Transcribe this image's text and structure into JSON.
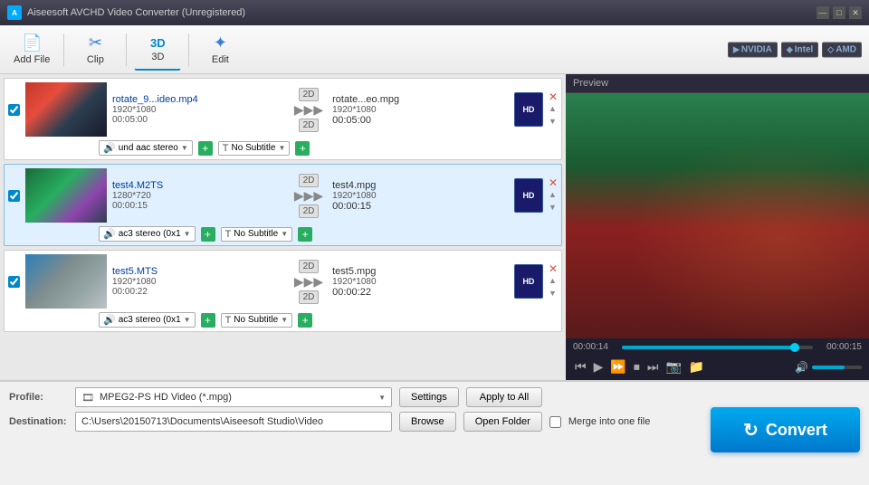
{
  "window": {
    "title": "Aiseesoft AVCHD Video Converter (Unregistered)"
  },
  "toolbar": {
    "add_file_label": "Add File",
    "clip_label": "Clip",
    "label_3d": "3D",
    "edit_label": "Edit",
    "hw_badges": [
      "NVIDIA",
      "Intel",
      "AMD"
    ]
  },
  "filelist": {
    "files": [
      {
        "id": "file1",
        "checked": true,
        "input_name": "rotate_9...ideo.mp4",
        "input_dim": "1920*1080",
        "input_dur": "00:05:00",
        "output_name": "rotate...eo.mpg",
        "output_dim": "1920*1080",
        "output_dur": "00:05:00",
        "audio": "und aac stereo",
        "subtitle": "No Subtitle",
        "thumb_class": "thumb-gradient-1",
        "selected": false
      },
      {
        "id": "file2",
        "checked": true,
        "input_name": "test4.M2TS",
        "input_dim": "1280*720",
        "input_dur": "00:00:15",
        "output_name": "test4.mpg",
        "output_dim": "1920*1080",
        "output_dur": "00:00:15",
        "audio": "ac3 stereo (0x1",
        "subtitle": "No Subtitle",
        "thumb_class": "thumb-gradient-2",
        "selected": true
      },
      {
        "id": "file3",
        "checked": true,
        "input_name": "test5.MTS",
        "input_dim": "1920*1080",
        "input_dur": "00:00:22",
        "output_name": "test5.mpg",
        "output_dim": "1920*1080",
        "output_dur": "00:00:22",
        "audio": "ac3 stereo (0x1",
        "subtitle": "No Subtitle",
        "thumb_class": "thumb-gradient-3",
        "selected": false
      }
    ]
  },
  "preview": {
    "label": "Preview",
    "time_current": "00:00:14",
    "time_total": "00:00:15"
  },
  "profile": {
    "label": "Profile:",
    "value": "MPEG2-PS HD Video (*.mpg)",
    "settings_label": "Settings",
    "apply_all_label": "Apply to All"
  },
  "destination": {
    "label": "Destination:",
    "path": "C:\\Users\\20150713\\Documents\\Aiseesoft Studio\\Video",
    "browse_label": "Browse",
    "open_folder_label": "Open Folder",
    "merge_label": "Merge into one file"
  },
  "convert_button": {
    "label": "Convert",
    "icon": "↻"
  }
}
